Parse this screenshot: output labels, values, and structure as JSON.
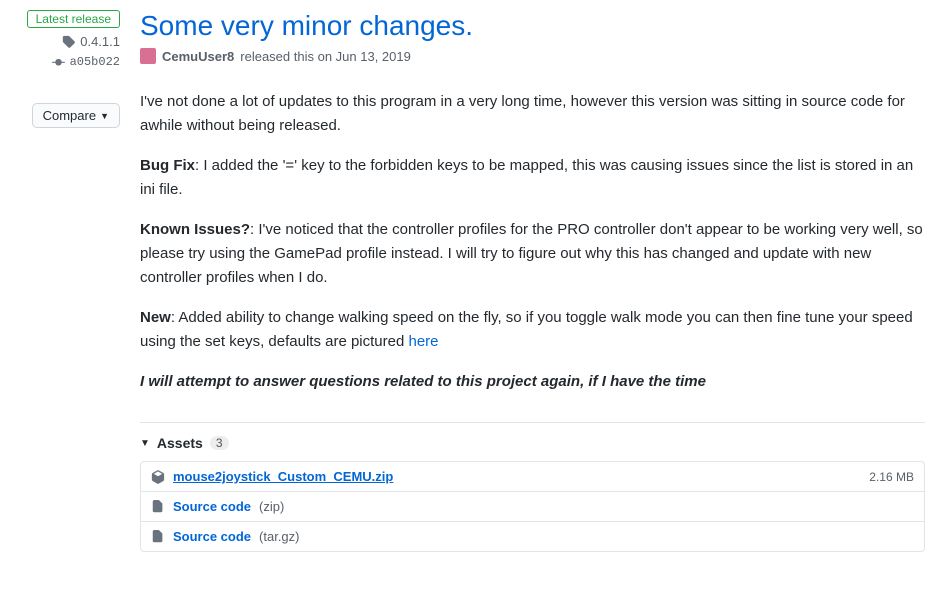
{
  "sidebar": {
    "latest_badge": "Latest release",
    "tag": "0.4.1.1",
    "commit": "a05b022",
    "compare_label": "Compare"
  },
  "release": {
    "title": "Some very minor changes.",
    "author": "CemuUser8",
    "released_text": " released this on Jun 13, 2019"
  },
  "body": {
    "p1": "I've not done a lot of updates to this program in a very long time, however this version was sitting in source code for awhile without being released.",
    "p2_label": "Bug Fix",
    "p2_text": ": I added the '=' key to the forbidden keys to be mapped, this was causing issues since the list is stored in an ini file.",
    "p3_label": "Known Issues?",
    "p3_text": ": I've noticed that the controller profiles for the PRO controller don't appear to be working very well, so please try using the GamePad profile instead. I will try to figure out why this has changed and update with new controller profiles when I do.",
    "p4_label": "New",
    "p4_text": ": Added ability to change walking speed on the fly, so if you toggle walk mode you can then fine tune your speed using the set keys, defaults are pictured ",
    "p4_link": "here",
    "p5": "I will attempt to answer questions related to this project again, if I have the time"
  },
  "assets": {
    "label": "Assets",
    "count": "3",
    "items": [
      {
        "name": "mouse2joystick_Custom_CEMU.zip",
        "ext": "",
        "size": "2.16 MB",
        "underlined": true,
        "icon": "package"
      },
      {
        "name": "Source code",
        "ext": " (zip)",
        "size": "",
        "underlined": false,
        "icon": "file-zip"
      },
      {
        "name": "Source code",
        "ext": " (tar.gz)",
        "size": "",
        "underlined": false,
        "icon": "file-zip"
      }
    ]
  }
}
